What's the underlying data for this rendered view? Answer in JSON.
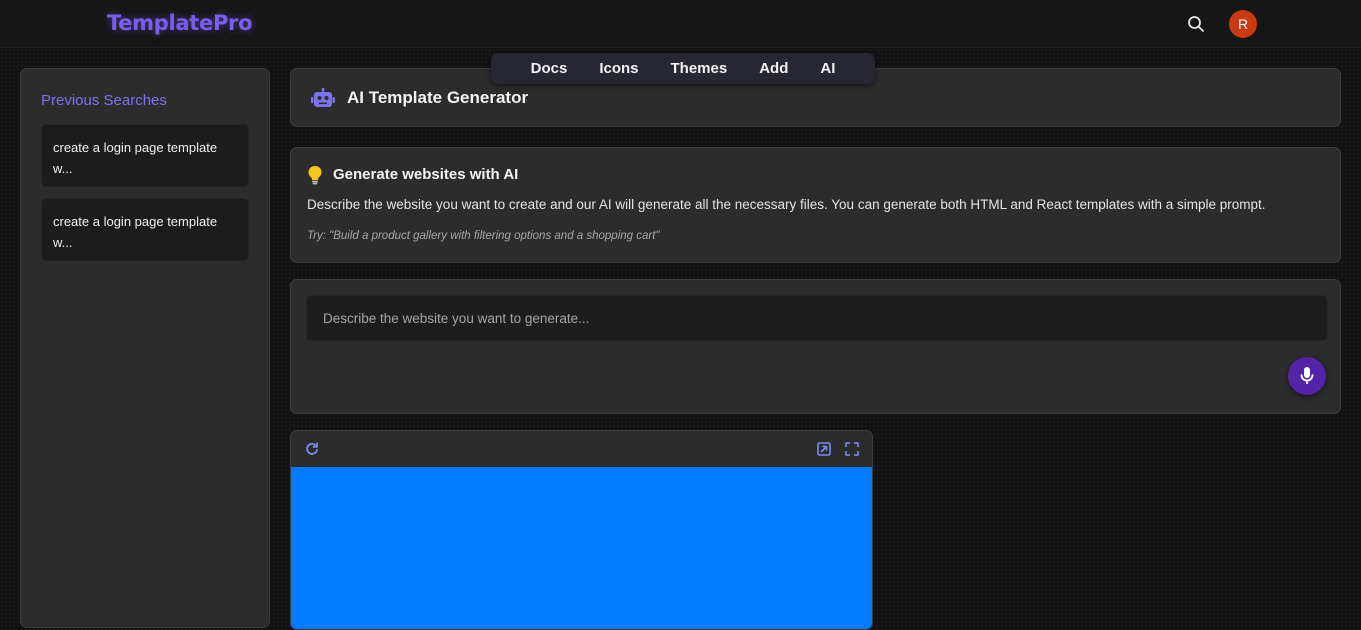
{
  "app": {
    "logo": "TemplatePro"
  },
  "header": {
    "avatar_initial": "R"
  },
  "nav": {
    "items": [
      "Docs",
      "Icons",
      "Themes",
      "Add",
      "AI"
    ]
  },
  "sidebar": {
    "title": "Previous Searches",
    "searches": [
      "create a login page template w...",
      "create a login page template w..."
    ]
  },
  "main": {
    "title": "AI Template Generator",
    "info": {
      "title": "Generate websites with AI",
      "description": "Describe the website you want to create and our AI will generate all the necessary files. You can generate both HTML and React templates with a simple prompt.",
      "example": "Try: \"Build a product gallery with filtering options and a shopping cart\""
    },
    "prompt": {
      "placeholder": "Describe the website you want to generate...",
      "value": ""
    }
  },
  "colors": {
    "accent": "#7b73ea",
    "mic_button": "#5424a8",
    "avatar": "#c93a14",
    "preview_background": "#007bff",
    "bulb": "#f5c518"
  },
  "icons": [
    "search-icon",
    "robot-icon",
    "lightbulb-icon",
    "microphone-icon",
    "refresh-icon",
    "open-external-icon",
    "fullscreen-icon"
  ]
}
